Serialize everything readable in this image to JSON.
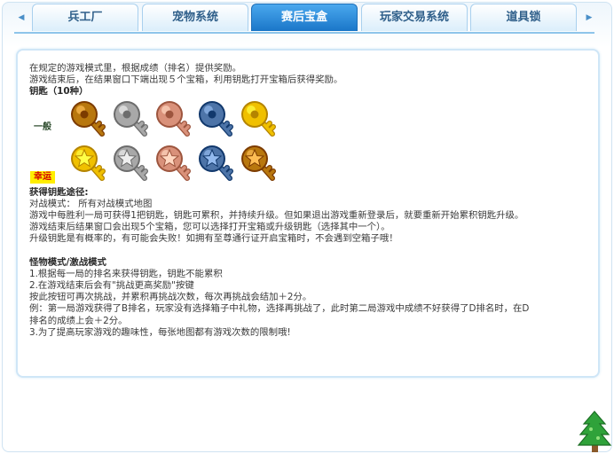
{
  "tabs": [
    {
      "label": "兵工厂",
      "active": false
    },
    {
      "label": "宠物系统",
      "active": false
    },
    {
      "label": "赛后宝盒",
      "active": true
    },
    {
      "label": "玩家交易系统",
      "active": false
    },
    {
      "label": "道具锁",
      "active": false
    }
  ],
  "intro": {
    "line1": "在规定的游戏模式里，根据成绩（排名）提供奖励。",
    "line2": "游戏结束后，在结果窗口下端出现５个宝箱，利用钥匙打开宝箱后获得奖励。",
    "keys_heading": "钥匙（10种）"
  },
  "key_rows": [
    {
      "label": "一般",
      "style": "plain",
      "colors": [
        "#b8770e",
        "#a8a8a8",
        "#d9917a",
        "#4d74a8",
        "#f0c000"
      ]
    },
    {
      "label": "幸运",
      "style": "star",
      "colors": [
        "#f0c000",
        "#a8a8a8",
        "#d9917a",
        "#4d74a8",
        "#b8770e"
      ]
    }
  ],
  "obtain": {
    "heading": "获得钥匙途径:",
    "line1": "对战模式： 所有对战模式地图",
    "line2": "游戏中每胜利一局可获得1把钥匙，钥匙可累积，并持续升级。但如果退出游戏重新登录后，就要重新开始累积钥匙升级。",
    "line3": "游戏结束后结果窗口会出现5个宝箱，您可以选择打开宝箱或升级钥匙（选择其中一个）。",
    "line4": "升级钥匙是有概率的，有可能会失败！如拥有至尊通行证开启宝箱时，不会遇到空箱子哦！"
  },
  "monster": {
    "heading": "怪物模式/激战模式",
    "line1": "1.根据每一局的排名来获得钥匙，钥匙不能累积",
    "line2": "2.在游戏结束后会有\"挑战更高奖励\"按键",
    "line3": "按此按钮可再次挑战，并累积再挑战次数，每次再挑战会结加＋2分。",
    "line4": "例：第一局游戏获得了B排名，玩家没有选择箱子中礼物，选择再挑战了，此时第二局游戏中成绩不好获得了D排名时，在D",
    "line5": "排名的成绩上会＋2分。",
    "line6": "3.为了提高玩家游戏的趣味性，每张地图都有游戏次数的限制哦!"
  },
  "icons": {
    "left_arrow": "arrow-left-icon",
    "right_arrow": "arrow-right-icon",
    "key": "key-icon",
    "tree": "tree-icon"
  }
}
